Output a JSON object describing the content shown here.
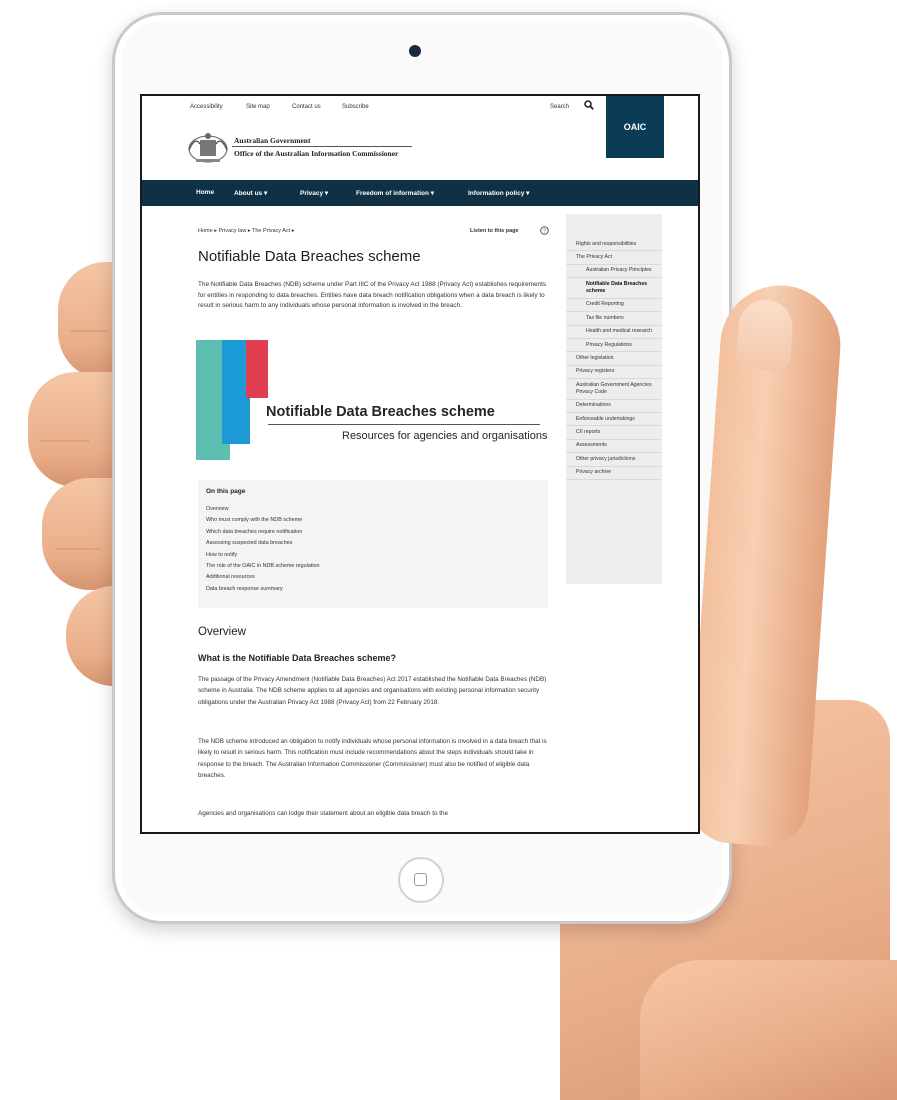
{
  "site": {
    "util_links": [
      "Accessibility",
      "Site map",
      "Contact us",
      "Subscribe"
    ],
    "search_label": "Search",
    "badge": "OAIC",
    "gov_line1": "Australian Government",
    "gov_line2": "Office of the Australian Information Commissioner"
  },
  "nav": [
    "Home",
    "About us ▾",
    "Privacy ▾",
    "Freedom of information ▾",
    "Information policy ▾"
  ],
  "breadcrumb": "Home  ▸  Privacy law  ▸  The Privacy Act  ▸",
  "listen": "Listen to this page",
  "page": {
    "title": "Notifiable Data Breaches scheme",
    "intro": "The Notifiable Data Breaches (NDB) scheme under Part IIIC of the Privacy Act 1988 (Privacy Act) establishes requirements for entities in responding to data breaches. Entities have data breach notification obligations when a data breach is likely to result in serious harm to any individuals whose personal information is involved in the breach.",
    "banner_title": "Notifiable Data Breaches scheme",
    "banner_subtitle": "Resources for agencies and organisations"
  },
  "on_this_page": {
    "title": "On this page",
    "items": [
      "Overview",
      "Who must comply with the NDB scheme",
      "Which data breaches require notification",
      "Assessing suspected data breaches",
      "How to notify",
      "The role of the OAIC in NDB scheme regulation",
      "Additional resources",
      "Data breach response summary"
    ]
  },
  "content": {
    "overview_heading": "Overview",
    "what_heading": "What is the Notifiable Data Breaches scheme?",
    "para1": "The passage of the Privacy Amendment (Notifiable Data Breaches) Act 2017 established the Notifiable Data Breaches (NDB) scheme in Australia. The NDB scheme applies to all agencies and organisations with existing personal information security obligations under the Australian Privacy Act 1988 (Privacy Act) from 22 February 2018.",
    "para2": "The NDB scheme introduced an obligation to notify individuals whose personal information is involved in a data breach that is likely to result in serious harm. This notification must include recommendations about the steps individuals should take in response to the breach. The Australian Information Commissioner (Commissioner) must also be notified of eligible data breaches.",
    "para3": "Agencies and organisations can lodge their statement about an eligible data breach to the"
  },
  "sidebar": [
    "Rights and responsibilities",
    "The Privacy Act",
    "Australian Privacy Principles",
    "Notifiable Data Breaches scheme",
    "Credit Reporting",
    "Tax file numbers",
    "Health and medical research",
    "Privacy Regulations",
    "Other legislation",
    "Privacy registers",
    "Australian Government Agencies Privacy Code",
    "Determinations",
    "Enforceable undertakings",
    "CII reports",
    "Assessments",
    "Other privacy jurisdictions",
    "Privacy archive"
  ],
  "colors": {
    "nav_bg": "#0f3146",
    "badge_bg": "#0c3b55",
    "banner_green": "#5cbfb1",
    "banner_blue": "#1c9ad6",
    "banner_red": "#e03f52"
  }
}
